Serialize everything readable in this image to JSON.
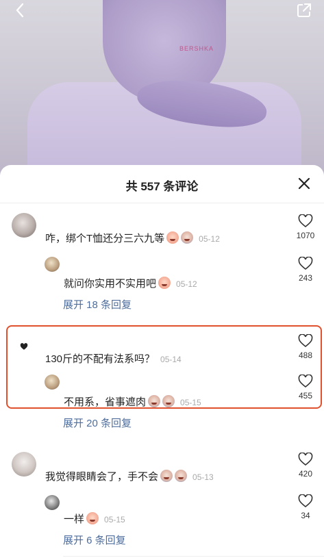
{
  "header": {
    "photo_logo_text": "BERSHKA"
  },
  "sheet": {
    "title": "共 557 条评论"
  },
  "comments": [
    {
      "text": "咋，绑个T恤还分三六九等",
      "date": "05-12",
      "likes": "1070",
      "reply": {
        "text": "就问你实用不实用吧",
        "date": "05-12",
        "likes": "243"
      },
      "expand": "展开 18 条回复"
    },
    {
      "text": "130斤的不配有法系吗？",
      "date": "05-14",
      "likes": "488",
      "reply": {
        "text": "不用系，省事遮肉",
        "date": "05-15",
        "likes": "455"
      },
      "expand": "展开 20 条回复"
    },
    {
      "text": "我觉得眼睛会了，手不会",
      "date": "05-13",
      "likes": "420",
      "reply": {
        "text": "一样",
        "date": "05-15",
        "likes": "34"
      },
      "expand": "展开 6 条回复"
    }
  ],
  "colors": {
    "highlight": "#e0502c",
    "link": "#4e6d9c"
  }
}
